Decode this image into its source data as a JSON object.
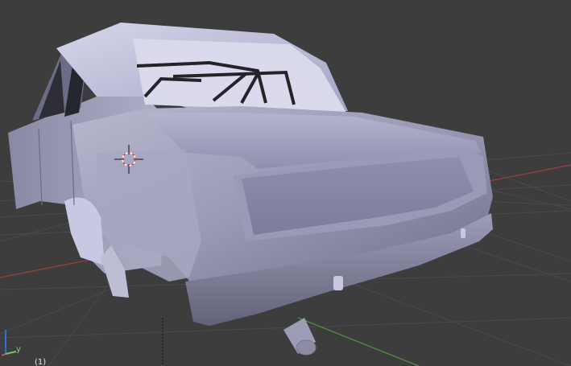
{
  "viewport": {
    "background": "#3d3d3d",
    "grid_color": "#4a4a4a",
    "x_axis_color": "#9b3e3e",
    "y_axis_color": "#4e9a3d"
  },
  "gizmo": {
    "y_label": "y",
    "z_color": "#2f6fd8",
    "x_color": "#d95050",
    "y_color": "#72c45d"
  },
  "status": {
    "frame": "(1)"
  },
  "icons": {
    "cursor": "3d-cursor-icon"
  }
}
